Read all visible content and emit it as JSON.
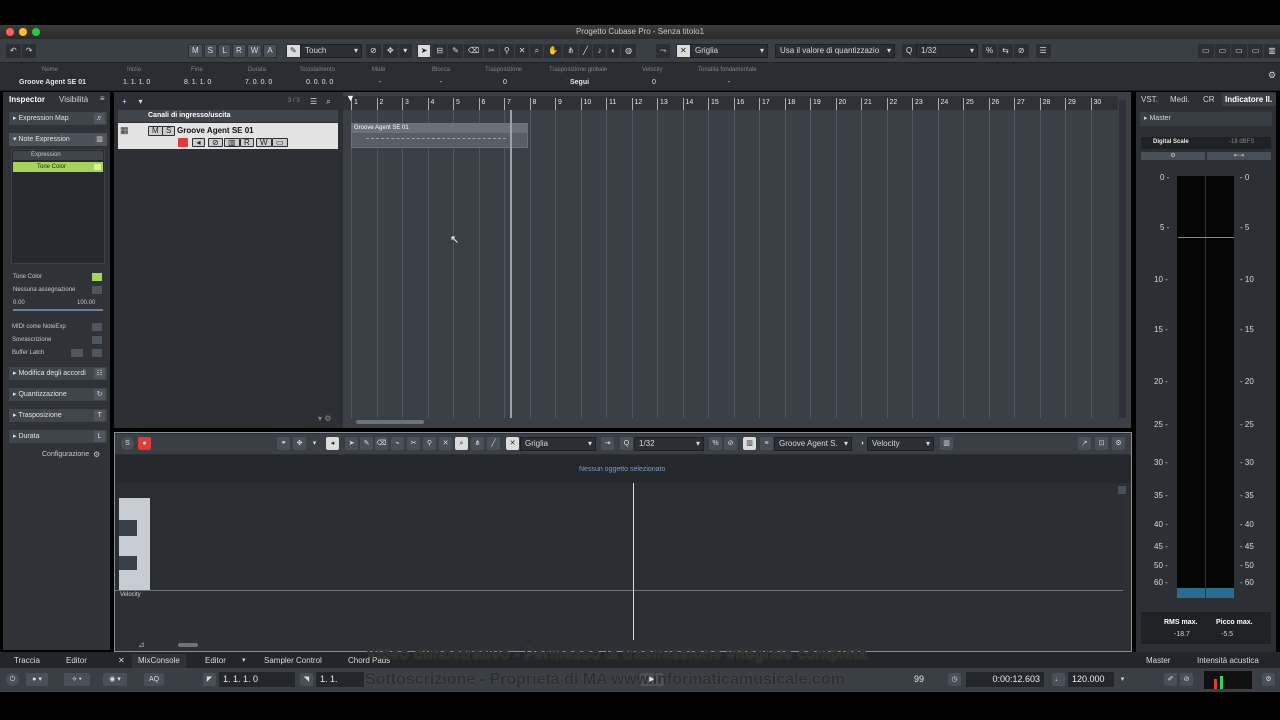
{
  "window": {
    "title": "Progetto Cubase Pro - Senza titolo1"
  },
  "toolbar": {
    "mute_solo": [
      "M",
      "S",
      "L",
      "R",
      "W",
      "A"
    ],
    "automation_mode": "Touch",
    "snap_type": "Griglia",
    "quantize_mode": "Usa il valore di quantizzazio",
    "quantize_value": "1/32"
  },
  "infoline": {
    "headers": [
      "Nome",
      "Inizio",
      "Fine",
      "Durata",
      "Scostamento",
      "Mute",
      "Blocca",
      "Trasposizione",
      "Trasposizione globale",
      "Velocity",
      "Tonalità fondamentale"
    ],
    "values": [
      "Groove Agent SE 01",
      "1. 1. 1.   0",
      "8. 1. 1.   0",
      "7. 0. 0.   0",
      "0. 0. 0.   0",
      "-",
      "-",
      "0",
      "Segui",
      "0",
      "-"
    ]
  },
  "inspector": {
    "tabs": [
      "Inspector",
      "Visibilità"
    ],
    "expression_map": "Expression Map",
    "note_expression": "Note Expression",
    "expression_item": "Expression",
    "tone_color": "Tone Color",
    "param_tone_color": "Tone Color",
    "assignment": "Nessuna assegnazione",
    "range_min": "0.00",
    "range_max": "100.00",
    "midi_as_noteexp": "MIDI come NoteExp",
    "overwrite": "Sovrascrizione",
    "buffer_latch": "Buffer Latch",
    "sections": [
      "Modifica degli accordi",
      "Quantizzazione",
      "Trasposizione",
      "Durata"
    ],
    "config": "Configurazione"
  },
  "project": {
    "track_count": "3 / 3",
    "folder_track": "Canali di ingresso/uscita",
    "track_name": "Groove Agent SE 01",
    "part_name": "Groove Agent SE 01",
    "ruler": [
      "1",
      "2",
      "3",
      "4",
      "5",
      "6",
      "7",
      "8",
      "9",
      "10",
      "11",
      "12",
      "13",
      "14",
      "15",
      "16",
      "17",
      "18",
      "19",
      "20",
      "21",
      "22",
      "23",
      "24",
      "25",
      "26",
      "27",
      "28",
      "29",
      "30"
    ]
  },
  "lower_editor": {
    "snap_type": "Griglia",
    "quantize": "1/32",
    "track_select": "Groove Agent S.",
    "lane_param": "Velocity",
    "status": "Nessun oggetto selezionato",
    "lane_label": "Velocity"
  },
  "right_zone": {
    "tabs": [
      "VST.",
      "Medi.",
      "CR",
      "Indicatore Il."
    ],
    "master": "Master",
    "digital_scale": "Digital Scale",
    "digital_scale_value": "-18 dBFS",
    "scale_marks": [
      "0",
      "5",
      "10",
      "15",
      "20",
      "25",
      "30",
      "35",
      "40",
      "45",
      "50",
      "60"
    ],
    "rms_label": "RMS max.",
    "rms_value": "-18.7",
    "peak_label": "Picco max.",
    "peak_value": "-5.5"
  },
  "bottom_tabs": {
    "left": [
      "Traccia",
      "Editor"
    ],
    "center": [
      "MixConsole",
      "Editor",
      "Sampler Control",
      "Chord Pads"
    ],
    "right": [
      "Master",
      "Intensità acustica"
    ]
  },
  "transport": {
    "left_locator": "1. 1. 1.   0",
    "right_locator": "1. 1.",
    "aq": "AQ",
    "beat": "99",
    "time": "0:00:12.603",
    "tempo": "120.000"
  },
  "watermark": {
    "line1": "Video dimostrativo - Permesso la trasmissione integrale completa",
    "line2": "Sottoscrizione - Proprietà di MA www.informaticamusicale.com"
  },
  "colors": {
    "accent": "#e03b3b",
    "tone_color": "#a6d35a",
    "selection": "#dcdcdc"
  }
}
